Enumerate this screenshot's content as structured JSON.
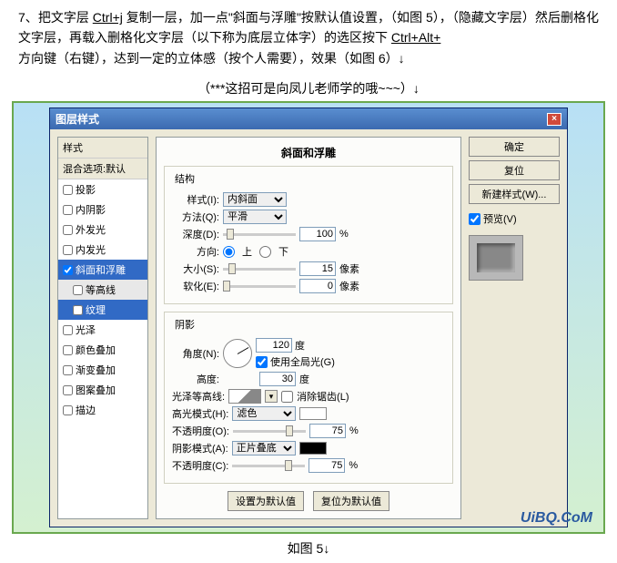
{
  "instructions": {
    "line1_prefix": "7、把文字层 ",
    "shortcut1": "Ctrl+j",
    "line1_mid": " 复制一层，加一点\"斜面与浮雕\"按默认值设置，（如图 5），（隐藏文字层）然后删格化文字层，再载入删格化文字层（以下称为底层立体字）的选区按下 ",
    "shortcut2": "Ctrl+Alt+",
    "line2": "方向键（右键），达到一定的立体感（按个人需要），效果（如图 6）↓",
    "note": "（***这招可是向凤儿老师学的哦~~~）↓"
  },
  "dialog": {
    "title": "图层样式",
    "close": "×"
  },
  "sidebar": {
    "header1": "样式",
    "header2": "混合选项:默认",
    "items": [
      {
        "label": "投影",
        "checked": false
      },
      {
        "label": "内阴影",
        "checked": false
      },
      {
        "label": "外发光",
        "checked": false
      },
      {
        "label": "内发光",
        "checked": false
      },
      {
        "label": "斜面和浮雕",
        "checked": true,
        "selected": true
      },
      {
        "label": "等高线",
        "checked": false,
        "sub": true
      },
      {
        "label": "纹理",
        "checked": false,
        "sub": true,
        "selected": true
      },
      {
        "label": "光泽",
        "checked": false
      },
      {
        "label": "颜色叠加",
        "checked": false
      },
      {
        "label": "渐变叠加",
        "checked": false
      },
      {
        "label": "图案叠加",
        "checked": false
      },
      {
        "label": "描边",
        "checked": false
      }
    ]
  },
  "center": {
    "title": "斜面和浮雕",
    "structure": {
      "legend": "结构",
      "style_label": "样式(I):",
      "style_value": "内斜面",
      "method_label": "方法(Q):",
      "method_value": "平滑",
      "depth_label": "深度(D):",
      "depth_value": "100",
      "depth_unit": "%",
      "direction_label": "方向:",
      "direction_up": "上",
      "direction_down": "下",
      "size_label": "大小(S):",
      "size_value": "15",
      "size_unit": "像素",
      "soften_label": "软化(E):",
      "soften_value": "0",
      "soften_unit": "像素"
    },
    "shading": {
      "legend": "阴影",
      "angle_label": "角度(N):",
      "angle_value": "120",
      "angle_unit": "度",
      "global_light": "使用全局光(G)",
      "altitude_label": "高度:",
      "altitude_value": "30",
      "altitude_unit": "度",
      "gloss_label": "光泽等高线:",
      "antialias": "消除锯齿(L)",
      "highlight_mode_label": "高光模式(H):",
      "highlight_mode_value": "滤色",
      "highlight_opacity_label": "不透明度(O):",
      "highlight_opacity_value": "75",
      "highlight_opacity_unit": "%",
      "shadow_mode_label": "阴影模式(A):",
      "shadow_mode_value": "正片叠底",
      "shadow_opacity_label": "不透明度(C):",
      "shadow_opacity_value": "75",
      "shadow_opacity_unit": "%"
    },
    "btn_default": "设置为默认值",
    "btn_reset": "复位为默认值"
  },
  "right": {
    "ok": "确定",
    "cancel": "复位",
    "new_style": "新建样式(W)...",
    "preview": "预览(V)"
  },
  "watermark": "UiBQ.CoM",
  "caption": "如图 5↓"
}
